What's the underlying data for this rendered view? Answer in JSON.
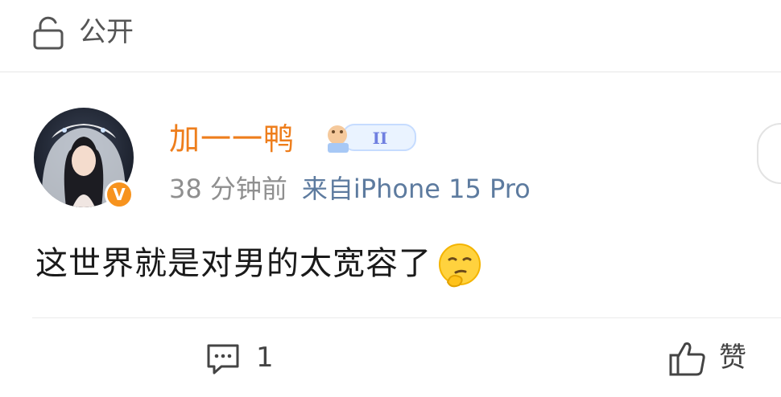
{
  "header": {
    "visibility_label": "公开"
  },
  "post": {
    "author": {
      "name": "加一一鸭",
      "verified_badge": "V",
      "level_badge": "II"
    },
    "meta": {
      "time": "38 分钟前",
      "source": "来自iPhone 15 Pro"
    },
    "text": "这世界就是对男的太宽容了",
    "emoji": "thinking-smirk-emoji"
  },
  "actions": {
    "reply_count": "1",
    "like_label": "赞"
  },
  "colors": {
    "username": "#ee7e1c",
    "device": "#5d7b9f",
    "verified": "#f7931e"
  }
}
